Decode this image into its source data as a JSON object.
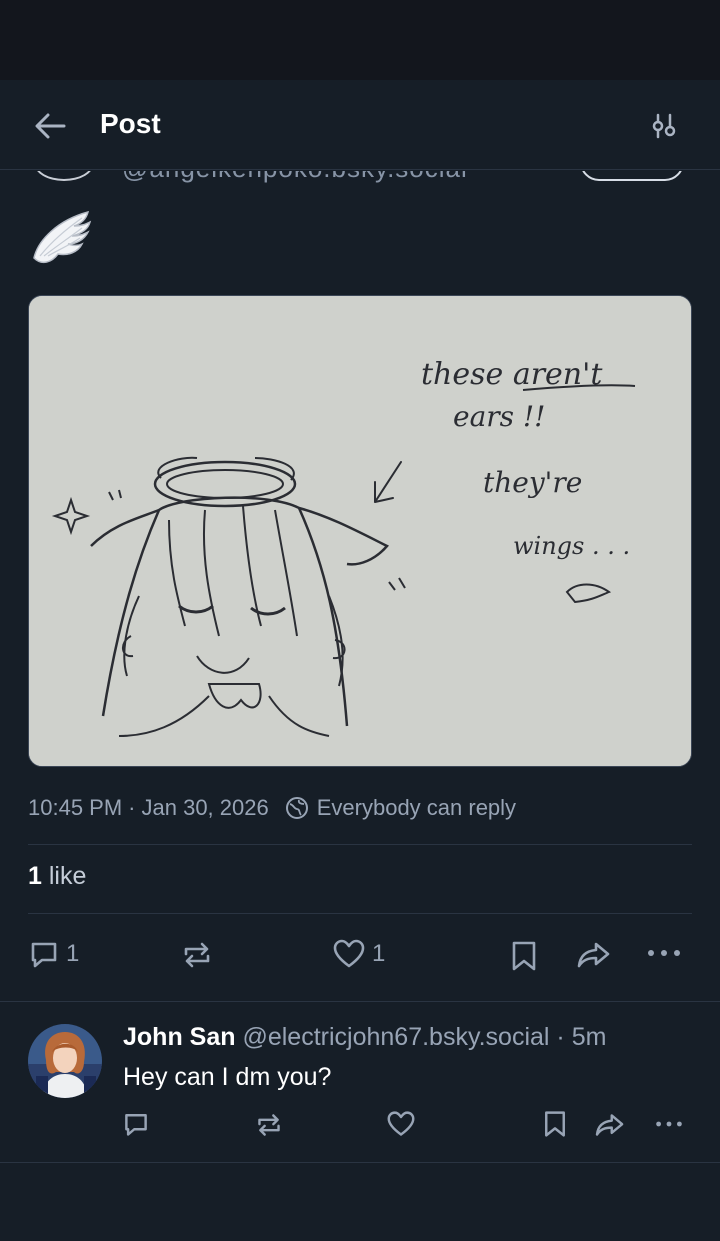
{
  "header": {
    "title": "Post",
    "back_icon": "arrow-left-icon",
    "filter_icon": "sliders-icon"
  },
  "post": {
    "handle_cutoff": "@angelkenpoko.bsky.social",
    "emoji": "wing",
    "image": {
      "description_icon": "drawing-image",
      "handwritten": [
        "these aren't",
        "ears !!",
        "they're",
        "wings . . ."
      ]
    },
    "time": "10:45 PM",
    "separator": "·",
    "date": "Jan 30, 2026",
    "reply_setting": "Everybody can reply",
    "like_count": "1",
    "like_label": "like",
    "actions": {
      "reply_count": "1",
      "like_count": "1"
    }
  },
  "reply": {
    "name": "John San",
    "handle": "@electricjohn67.bsky.social",
    "time": "· 5m",
    "text": "Hey can I dm you?"
  },
  "colors": {
    "background": "#161e27",
    "status_bar": "#13161d",
    "muted_text": "#98a4b5",
    "divider": "#2a3442"
  }
}
